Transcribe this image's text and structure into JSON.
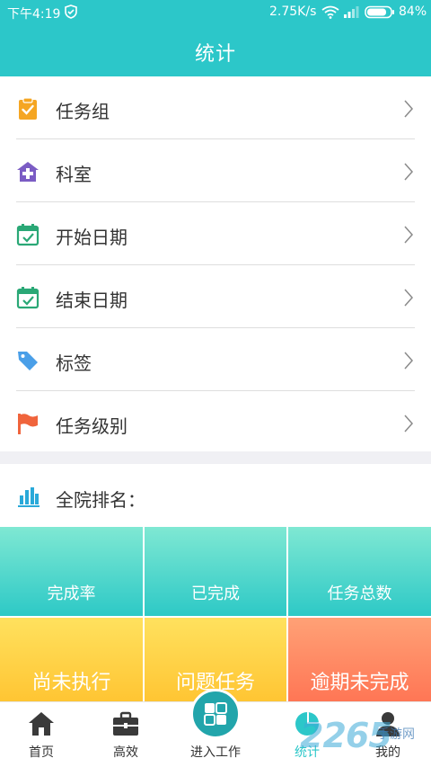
{
  "status_bar": {
    "time": "下午4:19",
    "net_speed": "2.75K/s",
    "battery": "84%"
  },
  "header": {
    "title": "统计"
  },
  "filters": [
    {
      "label": "任务组",
      "icon": "clipboard-icon",
      "color": "#f5a623"
    },
    {
      "label": "科室",
      "icon": "hospital-icon",
      "color": "#7b5cc4"
    },
    {
      "label": "开始日期",
      "icon": "calendar-check-icon",
      "color": "#2aa876"
    },
    {
      "label": "结束日期",
      "icon": "calendar-check-icon",
      "color": "#2aa876"
    },
    {
      "label": "标签",
      "icon": "tag-icon",
      "color": "#4a9fe8"
    },
    {
      "label": "任务级别",
      "icon": "flag-icon",
      "color": "#f0643c"
    }
  ],
  "ranking": {
    "label": "全院排名：",
    "icon": "bar-chart-icon"
  },
  "tiles": [
    {
      "label": "完成率",
      "color": "teal"
    },
    {
      "label": "已完成",
      "color": "teal"
    },
    {
      "label": "任务总数",
      "color": "teal"
    },
    {
      "label": "尚未执行",
      "color": "yellow"
    },
    {
      "label": "问题任务",
      "color": "yellow"
    },
    {
      "label": "逾期未完成",
      "color": "orange"
    }
  ],
  "bottom_nav": {
    "items": [
      {
        "label": "首页",
        "icon": "home-icon"
      },
      {
        "label": "高效",
        "icon": "briefcase-icon"
      },
      {
        "label": "进入工作",
        "icon": "enter-work-icon"
      },
      {
        "label": "统计",
        "icon": "pie-chart-icon",
        "active": true
      },
      {
        "label": "我的",
        "icon": "user-icon"
      }
    ]
  },
  "watermark": {
    "main": "2265",
    "sub": "手游网"
  },
  "colors": {
    "primary": "#2cc7c9",
    "text": "#333333"
  }
}
